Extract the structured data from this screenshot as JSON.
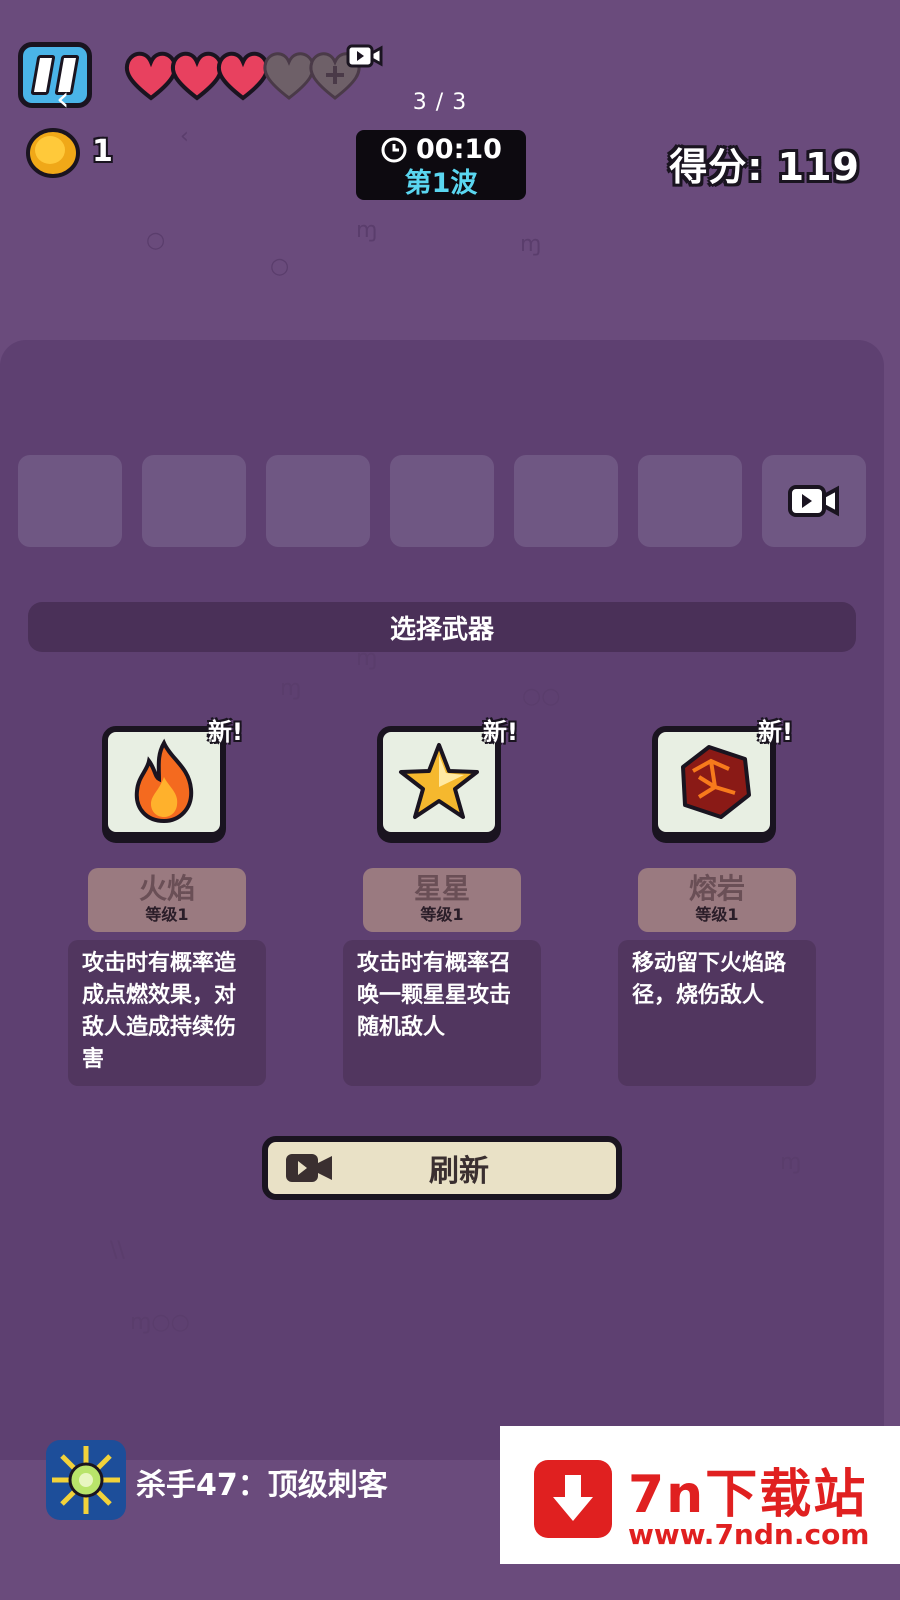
{
  "hud": {
    "lives_filled": 3,
    "lives_total": 5,
    "page_counter": "3 / 3",
    "coins": "1",
    "timer": "00:10",
    "wave": "第1波",
    "score": "得分: 119"
  },
  "inventory": {
    "slot_count": 6,
    "ad_slot_icon": "video-camera-icon"
  },
  "choose_title": "选择武器",
  "weapons": [
    {
      "icon": "fire-icon",
      "badge": "新!",
      "name": "火焰",
      "level": "等级1",
      "description": "攻击时有概率造成点燃效果，对敌人造成持续伤害"
    },
    {
      "icon": "star-icon",
      "badge": "新!",
      "name": "星星",
      "level": "等级1",
      "description": "攻击时有概率召唤一颗星星攻击随机敌人"
    },
    {
      "icon": "lava-rock-icon",
      "badge": "新!",
      "name": "熔岩",
      "level": "等级1",
      "description": "移动留下火焰路径，烧伤敌人"
    }
  ],
  "refresh_label": "刷新",
  "footer": {
    "app_title": "杀手47：顶级刺客",
    "watermark_title": "7n下载站",
    "watermark_url": "www.7ndn.com"
  },
  "colors": {
    "background": "#6a4b7c",
    "panel": "#5e4071",
    "heart": "#e8415f",
    "wave_text": "#5ad6f0",
    "watermark_red": "#e02020"
  }
}
